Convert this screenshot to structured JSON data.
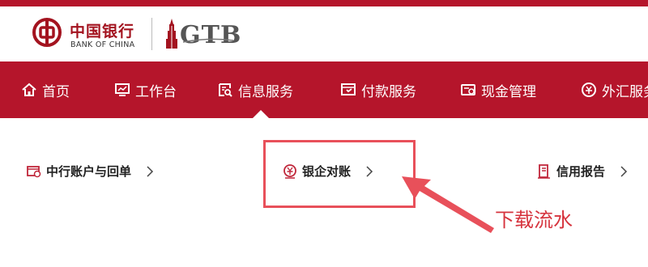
{
  "brand": {
    "name_cn": "中国银行",
    "name_en": "BANK OF CHINA",
    "sub_logo": "GTB",
    "primary_color": "#b5152b"
  },
  "nav": {
    "items": [
      {
        "label": "首页",
        "icon": "home-icon"
      },
      {
        "label": "工作台",
        "icon": "monitor-icon"
      },
      {
        "label": "信息服务",
        "icon": "info-search-icon",
        "active": true
      },
      {
        "label": "付款服务",
        "icon": "payment-icon"
      },
      {
        "label": "现金管理",
        "icon": "cash-management-icon"
      },
      {
        "label": "外汇服务",
        "icon": "fx-icon"
      }
    ]
  },
  "subnav": {
    "items": [
      {
        "label": "中行账户与回单",
        "icon": "account-receipt-icon"
      },
      {
        "label": "银企对账",
        "icon": "reconciliation-icon",
        "highlighted": true
      },
      {
        "label": "信用报告",
        "icon": "credit-report-icon"
      }
    ]
  },
  "annotation": {
    "text": "下载流水",
    "color": "#d6333d"
  }
}
